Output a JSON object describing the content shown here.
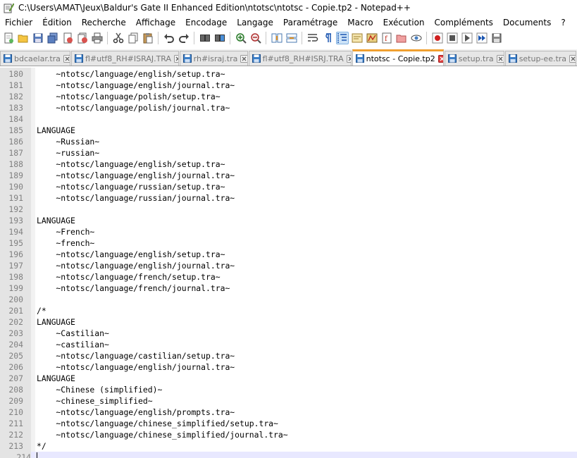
{
  "window": {
    "title": "C:\\Users\\AMAT\\Jeux\\Baldur's Gate II Enhanced Edition\\ntotsc\\ntotsc - Copie.tp2 - Notepad++"
  },
  "menu": {
    "items": [
      {
        "label": "Fichier"
      },
      {
        "label": "Édition"
      },
      {
        "label": "Recherche"
      },
      {
        "label": "Affichage"
      },
      {
        "label": "Encodage"
      },
      {
        "label": "Langage"
      },
      {
        "label": "Paramétrage"
      },
      {
        "label": "Macro"
      },
      {
        "label": "Exécution"
      },
      {
        "label": "Compléments"
      },
      {
        "label": "Documents"
      },
      {
        "label": "?"
      }
    ]
  },
  "toolbar": {
    "buttons": [
      {
        "icon": "new-file-icon"
      },
      {
        "icon": "open-file-icon"
      },
      {
        "icon": "save-icon"
      },
      {
        "icon": "save-all-icon"
      },
      {
        "icon": "close-icon"
      },
      {
        "icon": "close-all-icon"
      },
      {
        "icon": "print-icon"
      },
      {
        "sep": true
      },
      {
        "icon": "cut-icon"
      },
      {
        "icon": "copy-icon"
      },
      {
        "icon": "paste-icon"
      },
      {
        "sep": true
      },
      {
        "icon": "undo-icon"
      },
      {
        "icon": "redo-icon"
      },
      {
        "sep": true
      },
      {
        "icon": "find-icon"
      },
      {
        "icon": "replace-icon"
      },
      {
        "sep": true
      },
      {
        "icon": "zoom-in-icon"
      },
      {
        "icon": "zoom-out-icon"
      },
      {
        "sep": true
      },
      {
        "icon": "sync-vertical-icon"
      },
      {
        "icon": "sync-horizontal-icon"
      },
      {
        "sep": true
      },
      {
        "icon": "word-wrap-icon"
      },
      {
        "icon": "show-all-chars-icon"
      },
      {
        "icon": "indent-guide-icon",
        "active": true
      },
      {
        "icon": "user-defined-language-icon"
      },
      {
        "icon": "document-map-icon"
      },
      {
        "icon": "function-list-icon"
      },
      {
        "icon": "folder-as-workspace-icon"
      },
      {
        "icon": "monitoring-icon"
      },
      {
        "sep": true
      },
      {
        "icon": "record-macro-icon"
      },
      {
        "icon": "stop-macro-icon"
      },
      {
        "icon": "play-macro-icon"
      },
      {
        "icon": "run-macro-multiple-icon"
      },
      {
        "icon": "save-macro-icon"
      }
    ]
  },
  "tabs": [
    {
      "label": "bdcaelar.tra",
      "active": false,
      "color": "#3c7fc8"
    },
    {
      "label": "fl#utf8_RH#ISRAJ.TRA",
      "active": false,
      "color": "#3c7fc8"
    },
    {
      "label": "rh#israj.tra",
      "active": false,
      "color": "#3c7fc8"
    },
    {
      "label": "fl#utf8_RH#ISRJ.TRA",
      "active": false,
      "color": "#3c7fc8"
    },
    {
      "label": "ntotsc - Copie.tp2",
      "active": true,
      "color": "#3c7fc8"
    },
    {
      "label": "setup.tra",
      "active": false,
      "color": "#3c7fc8"
    },
    {
      "label": "setup-ee.tra",
      "active": false,
      "color": "#3c7fc8"
    }
  ],
  "editor": {
    "current_line": "214",
    "lines": [
      {
        "n": "180",
        "t": "    ~ntotsc/language/english/setup.tra~"
      },
      {
        "n": "181",
        "t": "    ~ntotsc/language/english/journal.tra~"
      },
      {
        "n": "182",
        "t": "    ~ntotsc/language/polish/setup.tra~"
      },
      {
        "n": "183",
        "t": "    ~ntotsc/language/polish/journal.tra~"
      },
      {
        "n": "184",
        "t": ""
      },
      {
        "n": "185",
        "t": "LANGUAGE"
      },
      {
        "n": "186",
        "t": "    ~Russian~"
      },
      {
        "n": "187",
        "t": "    ~russian~"
      },
      {
        "n": "188",
        "t": "    ~ntotsc/language/english/setup.tra~"
      },
      {
        "n": "189",
        "t": "    ~ntotsc/language/english/journal.tra~"
      },
      {
        "n": "190",
        "t": "    ~ntotsc/language/russian/setup.tra~"
      },
      {
        "n": "191",
        "t": "    ~ntotsc/language/russian/journal.tra~"
      },
      {
        "n": "192",
        "t": ""
      },
      {
        "n": "193",
        "t": "LANGUAGE"
      },
      {
        "n": "194",
        "t": "    ~French~"
      },
      {
        "n": "195",
        "t": "    ~french~"
      },
      {
        "n": "196",
        "t": "    ~ntotsc/language/english/setup.tra~"
      },
      {
        "n": "197",
        "t": "    ~ntotsc/language/english/journal.tra~"
      },
      {
        "n": "198",
        "t": "    ~ntotsc/language/french/setup.tra~"
      },
      {
        "n": "199",
        "t": "    ~ntotsc/language/french/journal.tra~"
      },
      {
        "n": "200",
        "t": ""
      },
      {
        "n": "201",
        "t": "/*"
      },
      {
        "n": "202",
        "t": "LANGUAGE"
      },
      {
        "n": "203",
        "t": "    ~Castilian~"
      },
      {
        "n": "204",
        "t": "    ~castilian~"
      },
      {
        "n": "205",
        "t": "    ~ntotsc/language/castilian/setup.tra~"
      },
      {
        "n": "206",
        "t": "    ~ntotsc/language/english/journal.tra~"
      },
      {
        "n": "207",
        "t": "LANGUAGE"
      },
      {
        "n": "208",
        "t": "    ~Chinese (simplified)~"
      },
      {
        "n": "209",
        "t": "    ~chinese_simplified~"
      },
      {
        "n": "210",
        "t": "    ~ntotsc/language/english/prompts.tra~"
      },
      {
        "n": "211",
        "t": "    ~ntotsc/language/chinese_simplified/setup.tra~"
      },
      {
        "n": "212",
        "t": "    ~ntotsc/language/chinese_simplified/journal.tra~"
      },
      {
        "n": "213",
        "t": "*/"
      },
      {
        "n": "214",
        "t": ""
      }
    ]
  }
}
